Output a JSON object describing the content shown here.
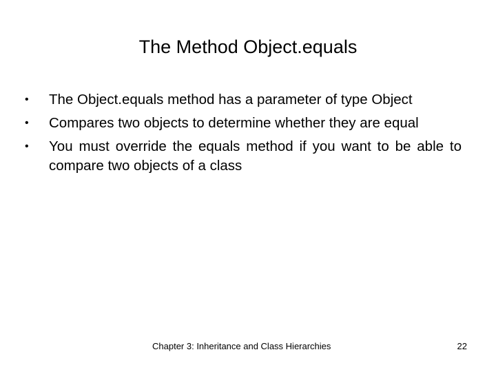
{
  "slide": {
    "title": "The Method Object.equals",
    "bullet_glyph": "•",
    "bullets": [
      {
        "text": "The Object.equals method has a parameter of type Object"
      },
      {
        "text": "Compares two objects to determine whether they are equal"
      },
      {
        "text": "You must override the equals method if you want to be able to compare two objects of a class"
      }
    ],
    "footer": "Chapter 3: Inheritance and Class Hierarchies",
    "page_number": "22"
  },
  "colors": {
    "background": "#ffffff",
    "text": "#000000"
  }
}
